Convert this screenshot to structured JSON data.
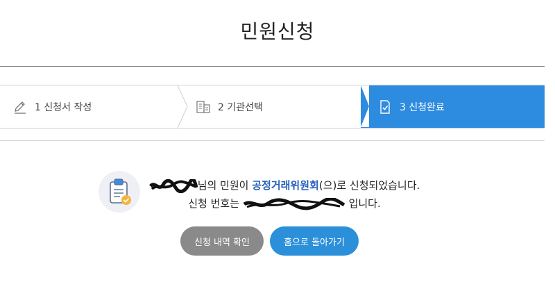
{
  "header": {
    "title": "민원신청"
  },
  "steps": [
    {
      "label": "1 신청서 작성",
      "icon": "pencil-icon",
      "active": false
    },
    {
      "label": "2 기관선택",
      "icon": "building-icon",
      "active": false
    },
    {
      "label": "3 신청완료",
      "icon": "document-check-icon",
      "active": true
    }
  ],
  "result": {
    "icon": "clipboard-check-icon",
    "line1_suffix": "님의 민원이 ",
    "agency": "공정거래위원회",
    "line1_end": "(으)로 신청되었습니다.",
    "line2_prefix": "신청 번호는 ",
    "line2_end": " 입니다."
  },
  "buttons": {
    "check_label": "신청 내역 확인",
    "home_label": "홈으로 돌아가기"
  },
  "colors": {
    "active_step": "#2d8be0",
    "agency_text": "#2560b8",
    "check_button": "#8a8a8a",
    "home_button": "#2b8fd9"
  }
}
